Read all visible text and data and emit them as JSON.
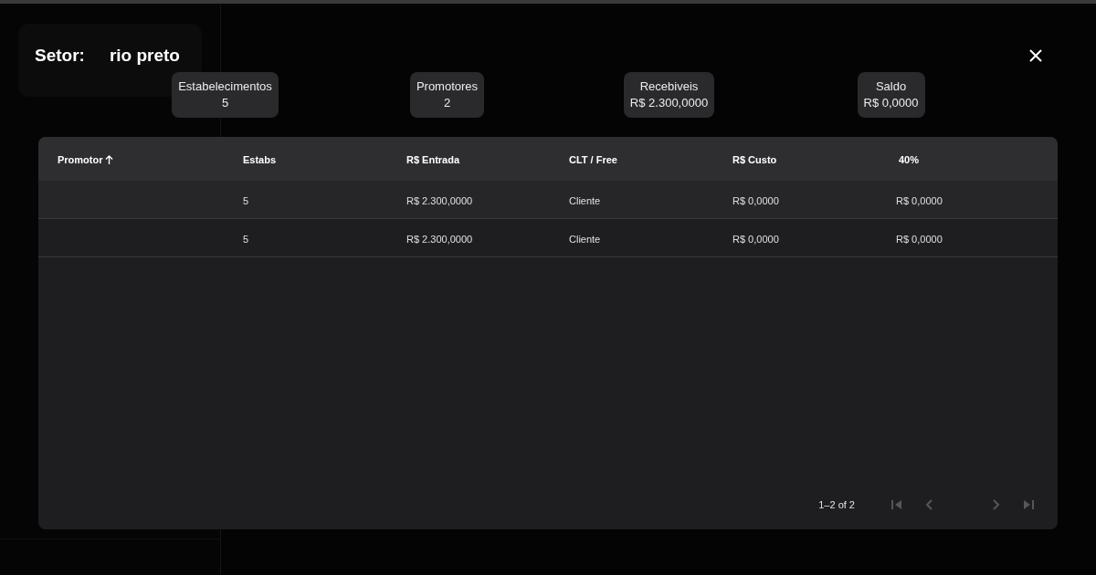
{
  "modal": {
    "title_label": "Setor:",
    "title_value": "rio preto",
    "stats": [
      {
        "label": "Estabelecimentos",
        "value": "5"
      },
      {
        "label": "Promotores",
        "value": "2"
      },
      {
        "label": "Recebiveis",
        "value": "R$ 2.300,0000"
      },
      {
        "label": "Saldo",
        "value": "R$ 0,0000"
      }
    ],
    "table": {
      "columns": [
        {
          "label": "Promotor",
          "sorted": true
        },
        {
          "label": "Estabs"
        },
        {
          "label": "R$ Entrada"
        },
        {
          "label": "CLT / Free"
        },
        {
          "label": "R$ Custo"
        },
        {
          "label": "40%"
        }
      ],
      "rows": [
        {
          "cells": [
            "",
            "5",
            "R$ 2.300,0000",
            "Cliente",
            "R$ 0,0000",
            "R$ 0,0000"
          ]
        },
        {
          "cells": [
            "",
            "5",
            "R$ 2.300,0000",
            "Cliente",
            "R$ 0,0000",
            "R$ 0,0000"
          ]
        }
      ]
    },
    "pagination": {
      "range": "1–2 of 2",
      "first_disabled": true,
      "prev_disabled": true,
      "next_disabled": true,
      "last_disabled": true
    }
  }
}
